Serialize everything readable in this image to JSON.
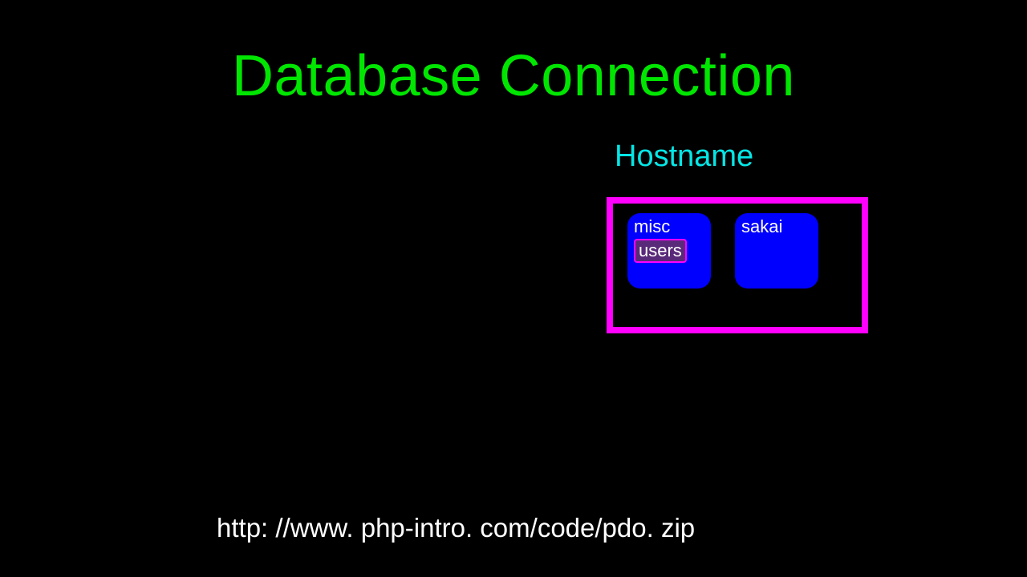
{
  "title": "Database Connection",
  "hostname_label": "Hostname",
  "host": {
    "databases": [
      {
        "name": "misc",
        "tables": [
          "users"
        ]
      },
      {
        "name": "sakai",
        "tables": []
      }
    ]
  },
  "footer_url": "http: //www. php-intro. com/code/pdo. zip",
  "colors": {
    "title": "#00e600",
    "hostname": "#05e6e6",
    "host_border": "#ff00ff",
    "db_bg": "#0000ff",
    "table_bg": "#5a2a7a"
  }
}
